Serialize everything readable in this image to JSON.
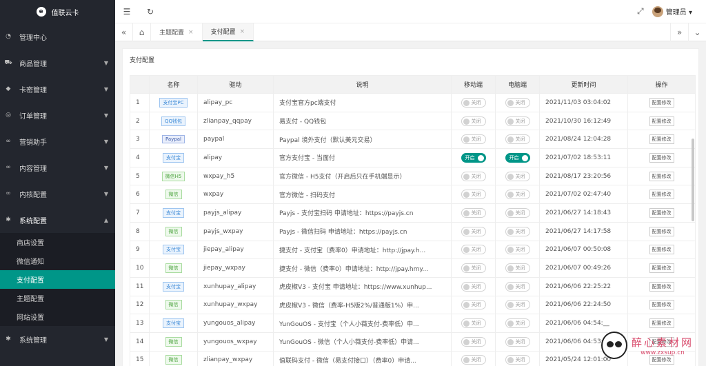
{
  "app": {
    "logo_letter": "e",
    "logo_text": "值联云卡"
  },
  "sidebar": {
    "items": [
      {
        "label": "管理中心",
        "icon": "gauge-icon",
        "glyph": "◔"
      },
      {
        "label": "商品管理",
        "icon": "cart-icon",
        "glyph": "⛟"
      },
      {
        "label": "卡密管理",
        "icon": "layers-icon",
        "glyph": "◆"
      },
      {
        "label": "订单管理",
        "icon": "order-icon",
        "glyph": "◎"
      },
      {
        "label": "营销助手",
        "icon": "link-icon",
        "glyph": "∞"
      },
      {
        "label": "内容管理",
        "icon": "link-icon",
        "glyph": "∞"
      },
      {
        "label": "内核配置",
        "icon": "link-icon",
        "glyph": "∞"
      }
    ],
    "open_section": {
      "label": "系统配置",
      "icon": "gear-icon",
      "glyph": "✱"
    },
    "sub_items": [
      "商店设置",
      "微信通知",
      "支付配置",
      "主题配置",
      "网站设置"
    ],
    "active_sub": "支付配置",
    "bottom_item": "系统管理"
  },
  "header": {
    "user": "管理员"
  },
  "tabs": [
    {
      "label": "主题配置",
      "active": false
    },
    {
      "label": "支付配置",
      "active": true
    }
  ],
  "card": {
    "title": "支付配置"
  },
  "table": {
    "columns": [
      "",
      "名称",
      "驱动",
      "说明",
      "移动端",
      "电脑端",
      "更新时间",
      "操作"
    ],
    "switch_on_label": "开启",
    "switch_off_label": "关闭",
    "op_label": "配置修改",
    "rows": [
      {
        "id": "1",
        "name": "支付宝PC",
        "name_style": "blue",
        "driver": "alipay_pc",
        "desc": "支付宝官方pc端支付",
        "mobile": false,
        "pc": false,
        "time": "2021/11/03 03:04:02"
      },
      {
        "id": "2",
        "name": "QQ钱包",
        "name_style": "blue",
        "driver": "zlianpay_qqpay",
        "desc": "易支付 - QQ钱包",
        "mobile": false,
        "pc": false,
        "time": "2021/10/30 16:12:49"
      },
      {
        "id": "3",
        "name": "Paypal",
        "name_style": "paypal",
        "driver": "paypal",
        "desc": "Paypal 境外支付（默认美元交易）",
        "mobile": false,
        "pc": false,
        "time": "2021/08/24 12:04:28"
      },
      {
        "id": "4",
        "name": "支付宝",
        "name_style": "blue",
        "driver": "alipay",
        "desc": "官方支付宝 - 当面付",
        "mobile": true,
        "pc": true,
        "time": "2021/07/02 18:53:11"
      },
      {
        "id": "5",
        "name": "微信H5",
        "name_style": "green",
        "driver": "wxpay_h5",
        "desc": "官方微信 - H5支付（开启后只在手机端显示）",
        "mobile": false,
        "pc": false,
        "time": "2021/08/17 23:20:56"
      },
      {
        "id": "6",
        "name": "微信",
        "name_style": "green",
        "driver": "wxpay",
        "desc": "官方微信 - 扫码支付",
        "mobile": false,
        "pc": false,
        "time": "2021/07/02 02:47:40"
      },
      {
        "id": "7",
        "name": "支付宝",
        "name_style": "blue",
        "driver": "payjs_alipay",
        "desc": "Payjs - 支付宝扫码 申请地址：https://payjs.cn",
        "mobile": false,
        "pc": false,
        "time": "2021/06/27 14:18:43"
      },
      {
        "id": "8",
        "name": "微信",
        "name_style": "green",
        "driver": "payjs_wxpay",
        "desc": "Payjs - 微信扫码 申请地址：https://payjs.cn",
        "mobile": false,
        "pc": false,
        "time": "2021/06/27 14:17:58"
      },
      {
        "id": "9",
        "name": "支付宝",
        "name_style": "blue",
        "driver": "jiepay_alipay",
        "desc": "捷支付 - 支付宝（费率0）申请地址：http://jpay.h...",
        "mobile": false,
        "pc": false,
        "time": "2021/06/07 00:50:08"
      },
      {
        "id": "10",
        "name": "微信",
        "name_style": "green",
        "driver": "jiepay_wxpay",
        "desc": "捷支付 - 微信（费率0）申请地址：http://jpay.hmy...",
        "mobile": false,
        "pc": false,
        "time": "2021/06/07 00:49:26"
      },
      {
        "id": "11",
        "name": "支付宝",
        "name_style": "blue",
        "driver": "xunhupay_alipay",
        "desc": "虎皮椒V3 - 支付宝 申请地址：https://www.xunhup...",
        "mobile": false,
        "pc": false,
        "time": "2021/06/06 22:25:22"
      },
      {
        "id": "12",
        "name": "微信",
        "name_style": "green",
        "driver": "xunhupay_wxpay",
        "desc": "虎皮椒V3 - 微信（费率-H5版2%/普通版1%）申...",
        "mobile": false,
        "pc": false,
        "time": "2021/06/06 22:24:50"
      },
      {
        "id": "13",
        "name": "支付宝",
        "name_style": "blue",
        "driver": "yungouos_alipay",
        "desc": "YunGouOS - 支付宝（个人小薇支付-费率低）申...",
        "mobile": false,
        "pc": false,
        "time": "2021/06/06 04:54:__"
      },
      {
        "id": "14",
        "name": "微信",
        "name_style": "green",
        "driver": "yungouos_wxpay",
        "desc": "YunGouOS - 微信（个人小薇支付-费率低）申请...",
        "mobile": false,
        "pc": false,
        "time": "2021/06/06 04:53:__"
      },
      {
        "id": "15",
        "name": "微信",
        "name_style": "green",
        "driver": "zlianpay_wxpay",
        "desc": "值联码支付 - 微信（易支付接口）（费率0）申请...",
        "mobile": false,
        "pc": false,
        "time": "2021/05/24 12:01:00"
      }
    ]
  },
  "watermark": {
    "title": "醉心素材网",
    "sub": "www.zxsup.cn"
  },
  "colors": {
    "sidebar_bg": "#23262e",
    "accent": "#009688"
  }
}
